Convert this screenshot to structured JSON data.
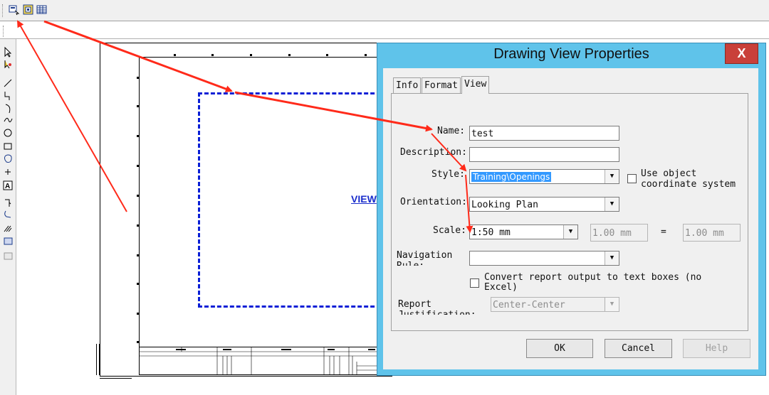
{
  "toolbar": {
    "icons": [
      "view-properties-icon",
      "reference-file-icon",
      "table-grid-icon"
    ]
  },
  "left_tools": [
    "select-arrow-icon",
    "select-multi-icon",
    "line-icon",
    "polyline-icon",
    "arc-icon",
    "curve-icon",
    "circle-icon",
    "rectangle-icon",
    "shape-icon",
    "point-icon",
    "text-icon",
    "dimension-icon",
    "revision-cloud-icon",
    "hatch-icon",
    "raster-icon",
    "image-icon"
  ],
  "drawing": {
    "view_label": "VIEW",
    "viewport_color": "#0a1fd6"
  },
  "dialog": {
    "title": "Drawing View Properties",
    "close_label": "X",
    "tabs": [
      "Info",
      "Format",
      "View"
    ],
    "active_tab": "View",
    "name_label": "Name:",
    "name_value": "test",
    "description_label": "Description:",
    "description_value": "",
    "style_label": "Style:",
    "style_value": "Training\\Openings",
    "use_object_coordinate_label": "Use object\ncoordinate system",
    "orientation_label": "Orientation:",
    "orientation_value": "Looking Plan",
    "scale_label": "Scale:",
    "scale_value": "1:50 mm",
    "scale_left_value": "1.00 mm",
    "scale_equals": "=",
    "scale_right_value": "1.00 mm",
    "navigation_label": "Navigation\nRule:",
    "navigation_value": "",
    "convert_label": "Convert report output to text boxes (no\nExcel)",
    "report_label": "Report\nJustification:",
    "report_value": "Center-Center",
    "ok_label": "OK",
    "cancel_label": "Cancel",
    "help_label": "Help",
    "title_bar_color": "#5fc3ea",
    "close_color": "#c9403a"
  },
  "annotation_arrow_color": "#ff2a1a"
}
